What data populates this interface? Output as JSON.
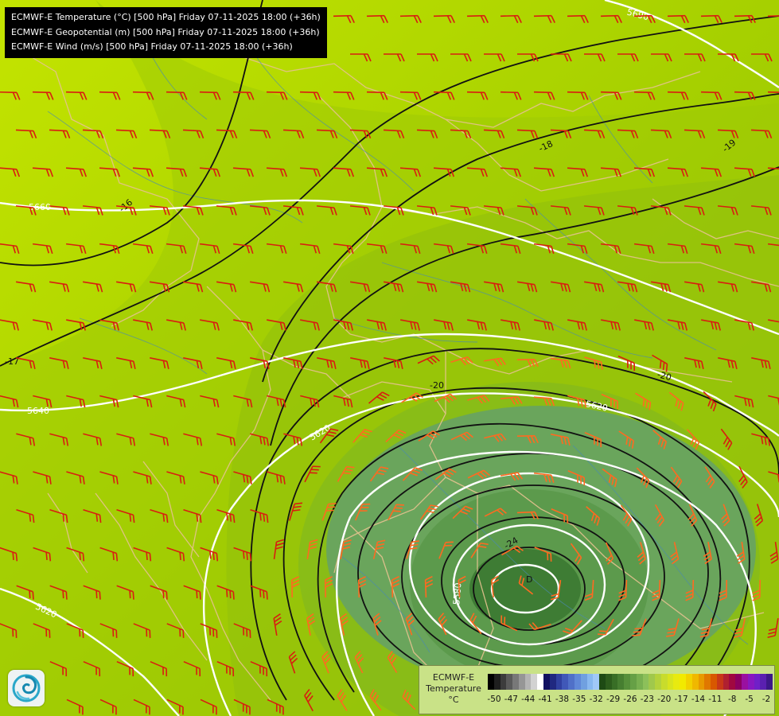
{
  "title": {
    "lines": [
      "ECMWF-E Temperature (°C) [500 hPa] Friday 07-11-2025 18:00 (+36h)",
      "ECMWF-E Geopotential (m) [500 hPa] Friday 07-11-2025 18:00 (+36h)",
      "ECMWF-E Wind (m/s) [500 hPa] Friday 07-11-2025 18:00 (+36h)"
    ]
  },
  "legend": {
    "title_line1": "ECMWF-E",
    "title_line2": "Temperature",
    "unit": "°C",
    "tick_labels": [
      "-50",
      "-47",
      "-44",
      "-41",
      "-38",
      "-35",
      "-32",
      "-29",
      "-26",
      "-23",
      "-20",
      "-17",
      "-14",
      "-11",
      "-8",
      "-5",
      "-2"
    ],
    "colors": [
      "#000000",
      "#1e1e1e",
      "#3c3c3c",
      "#5a5a5a",
      "#787878",
      "#969696",
      "#b4b4b4",
      "#d2d2d2",
      "#ffffff",
      "#101060",
      "#202880",
      "#3040a0",
      "#4058b8",
      "#5070c8",
      "#6088d8",
      "#70a0e0",
      "#88b8f0",
      "#a0c8f8",
      "#1e4a14",
      "#2c5c1c",
      "#386e26",
      "#467e30",
      "#56903a",
      "#66a046",
      "#78b050",
      "#8cc05a",
      "#a0c84c",
      "#b4d23c",
      "#c8dc2c",
      "#d8e41e",
      "#e8ea10",
      "#f2ea00",
      "#f2d200",
      "#f0b800",
      "#e89a00",
      "#e07800",
      "#d85800",
      "#c83818",
      "#b02030",
      "#a00840",
      "#8c0060",
      "#9a10a0",
      "#8818c0",
      "#7020c8",
      "#5a20b0",
      "#3c1888"
    ]
  },
  "contour_labels": {
    "geopotential": [
      "5690",
      "5660",
      "5640",
      "5620",
      "5620",
      "5620",
      "5580"
    ],
    "temperature": [
      "-16",
      "-17",
      "-18",
      "-19",
      "-20",
      "-20",
      "-24"
    ]
  },
  "logo_icon": "ecmwf-swirl-icon"
}
